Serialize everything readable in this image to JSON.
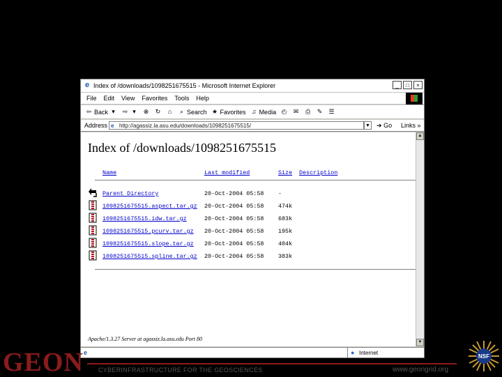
{
  "window": {
    "title": "Index of /downloads/1098251675515 - Microsoft Internet Explorer",
    "controls": [
      "_",
      "□",
      "×"
    ]
  },
  "menu": [
    "File",
    "Edit",
    "View",
    "Favorites",
    "Tools",
    "Help"
  ],
  "toolbar": {
    "back": "Back",
    "forward": "",
    "search": "Search",
    "favorites": "Favorites",
    "media": "Media"
  },
  "address": {
    "label": "Address",
    "url": "http://agassiz.la.asu.edu/downloads/1098251675515/",
    "go": "Go",
    "links": "Links »"
  },
  "page": {
    "heading": "Index of /downloads/1098251675515",
    "columns": {
      "name": "Name",
      "modified": "Last modified",
      "size": "Size",
      "description": "Description"
    },
    "rows": [
      {
        "name": "Parent Directory",
        "modified": "20-Oct-2004 05:58",
        "size": "-",
        "icon": "back-arrow-icon"
      },
      {
        "name": "1098251675515.aspect.tar.gz",
        "modified": "20-Oct-2004 05:58",
        "size": "474k",
        "icon": "archive-icon"
      },
      {
        "name": "1098251675515.idw.tar.gz",
        "modified": "20-Oct-2004 05:58",
        "size": "683k",
        "icon": "archive-icon"
      },
      {
        "name": "1098251675515.pcurv.tar.gz",
        "modified": "20-Oct-2004 05:58",
        "size": "195k",
        "icon": "archive-icon"
      },
      {
        "name": "1098251675515.slope.tar.gz",
        "modified": "20-Oct-2004 05:58",
        "size": "404k",
        "icon": "archive-icon"
      },
      {
        "name": "1098251675515.spline.tar.gz",
        "modified": "20-Oct-2004 05:58",
        "size": "383k",
        "icon": "archive-icon"
      }
    ],
    "server_footer": "Apache/1.3.27 Server at agassiz.la.asu.edu Port 80"
  },
  "status": {
    "zone": "Internet"
  },
  "slide": {
    "logo": "GEON",
    "footer_left": "CYBERINFRASTRUCTURE FOR THE GEOSCIENCES",
    "footer_right": "www.geongrid.org",
    "nsf_logo_text": "NSF"
  },
  "colors": {
    "accent": "#8b1c1c",
    "link": "#0000cc",
    "background": "#000000"
  }
}
